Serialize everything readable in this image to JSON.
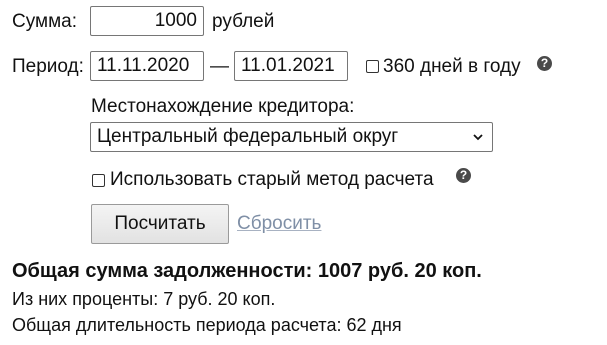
{
  "form": {
    "sum_label": "Сумма:",
    "sum_value": "1000",
    "sum_unit": "рублей",
    "period_label": "Период:",
    "date_from": "11.11.2020",
    "date_separator": "—",
    "date_to": "11.01.2021",
    "days360_label": "360 дней в году",
    "days360_checked": false,
    "creditor_location_label": "Местонахождение кредитора:",
    "creditor_location_value": "Центральный федеральный округ",
    "old_method_label": "Использовать старый метод расчета",
    "old_method_checked": false,
    "calculate_label": "Посчитать",
    "reset_label": "Сбросить"
  },
  "results": {
    "total_debt": "Общая сумма задолженности: 1007 руб. 20 коп.",
    "interest": "Из них проценты: 7 руб. 20 коп.",
    "duration": "Общая длительность периода расчета: 62 дня"
  },
  "icons": {
    "help": "question-circle-icon",
    "dropdown": "chevron-down-icon"
  }
}
